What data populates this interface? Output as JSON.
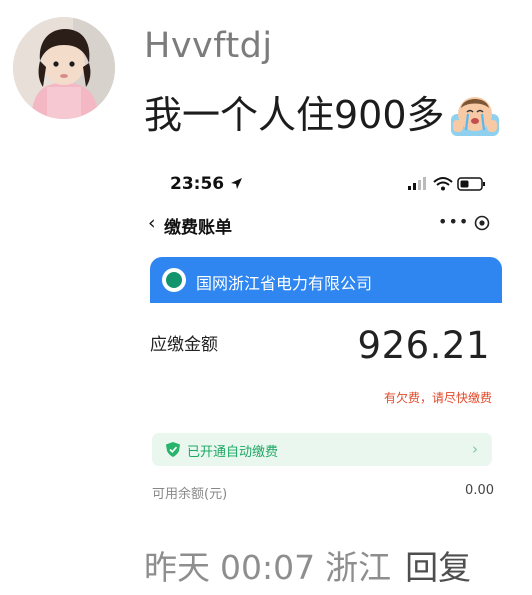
{
  "comment": {
    "username": "Hvvftdj",
    "text": "我一个人住900多",
    "emoji_icon": "crying-face-icon",
    "date": "昨天",
    "time": "00:07",
    "location": "浙江",
    "reply_label": "回复"
  },
  "screenshot": {
    "status_time": "23:56",
    "nav_title": "缴费账单",
    "more_label": "•••",
    "company": "国网浙江省电力有限公司",
    "due_label": "应缴金额",
    "due_amount": "926.21",
    "overdue_notice": "有欠费，请尽快缴费",
    "autopay_label": "已开通自动缴费",
    "balance_label": "可用余额(元)",
    "balance_value": "0.00",
    "colors": {
      "card_blue": "#2f86f1",
      "alert_red": "#e24a2a",
      "autopay_green": "#1fa865"
    }
  }
}
